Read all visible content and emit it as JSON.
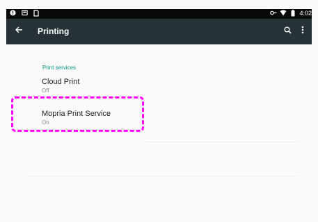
{
  "status_bar": {
    "left_icons": [
      "alert-icon",
      "screenshot-icon",
      "sim-icon"
    ],
    "right_icons": [
      "vpn-key-icon",
      "wifi-icon",
      "battery-icon"
    ],
    "time": "4:02"
  },
  "app_bar": {
    "back_icon": "back-arrow-icon",
    "title": "Printing",
    "search_icon": "search-icon",
    "overflow_icon": "more-vert-icon",
    "background_color": "#263238"
  },
  "section": {
    "header": "Print services",
    "header_color": "#009688"
  },
  "items": [
    {
      "title": "Cloud Print",
      "summary": "Off"
    },
    {
      "title": "Mopria Print Service",
      "summary": "On"
    }
  ],
  "annotation": {
    "color": "#ff00ff",
    "style": "dashed"
  }
}
